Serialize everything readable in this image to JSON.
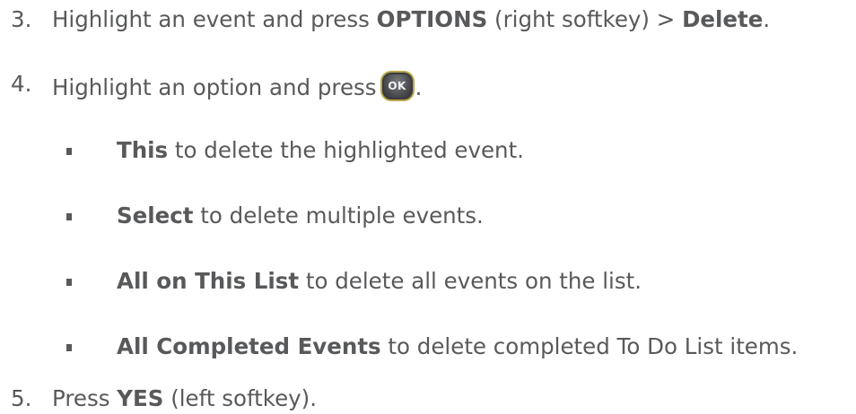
{
  "steps": [
    {
      "number": "3.",
      "pre": "Highlight an event and press ",
      "bold1": "OPTIONS",
      "mid": " (right softkey) > ",
      "bold2": "Delete",
      "post": "."
    },
    {
      "number": "4.",
      "pre": "Highlight an option and press",
      "button_label": "OK",
      "post": "."
    },
    {
      "number": "5.",
      "pre": "Press ",
      "bold": "YES",
      "post": " (left softkey)."
    }
  ],
  "options": [
    {
      "bold": "This",
      "text": " to delete the highlighted event."
    },
    {
      "bold": "Select",
      "text": " to delete multiple events."
    },
    {
      "bold": "All on This List",
      "text": " to delete all events on the list."
    },
    {
      "bold": "All Completed Events",
      "text": " to delete completed To Do List items."
    }
  ],
  "colors": {
    "text": "#58595b",
    "button_border": "#b9a64a"
  },
  "icons": {
    "ok_button": "ok-button-icon",
    "bullet": "square-bullet"
  }
}
